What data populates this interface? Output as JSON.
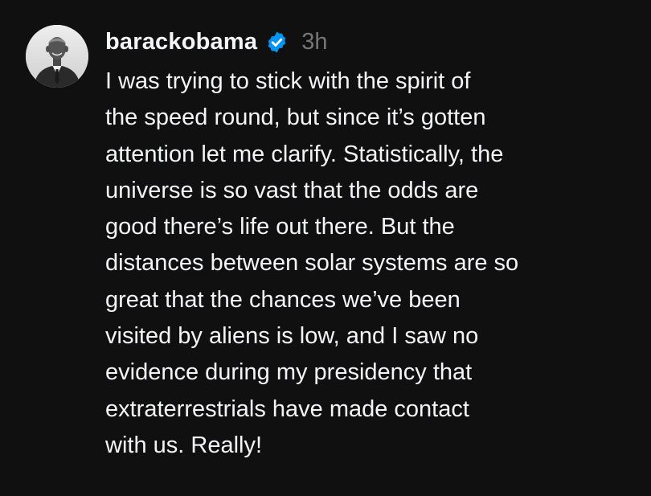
{
  "post": {
    "author": {
      "username": "barackobama",
      "verified": true,
      "avatar_icon": "profile-photo",
      "badge_icon": "verified-badge-icon"
    },
    "timestamp": "3h",
    "text_lines": [
      "I was trying to stick with the spirit of",
      "the speed round, but since it’s gotten",
      "attention let me clarify. Statistically, the",
      "universe is so vast that the odds are",
      "good there’s life out there. But the",
      "distances between solar systems are so",
      "great that the chances we’ve been",
      "visited by aliens is low, and I saw no",
      "evidence during my presidency that",
      "extraterrestrials have made contact",
      "with us. Really!"
    ]
  },
  "colors": {
    "background": "#101010",
    "primary_text": "#f3f5f7",
    "secondary_text": "#777777",
    "verified_blue": "#0095f6"
  }
}
